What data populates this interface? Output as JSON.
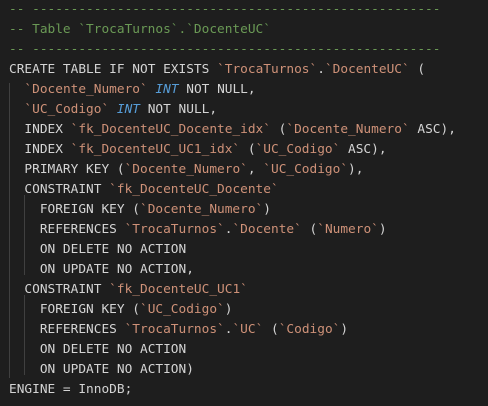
{
  "editor": {
    "lines": [
      [
        {
          "t": "-- -----------------------------------------------------",
          "c": "cmt"
        }
      ],
      [
        {
          "t": "-- Table `TrocaTurnos`.`DocenteUC`",
          "c": "cmt"
        }
      ],
      [
        {
          "t": "-- -----------------------------------------------------",
          "c": "cmt"
        }
      ],
      [
        {
          "t": "CREATE TABLE ",
          "c": "kw"
        },
        {
          "t": "IF NOT EXISTS",
          "c": "kw"
        },
        {
          "t": " ",
          "c": "pn"
        },
        {
          "t": "`TrocaTurnos`",
          "c": "str"
        },
        {
          "t": ".",
          "c": "pn"
        },
        {
          "t": "`DocenteUC`",
          "c": "str"
        },
        {
          "t": " (",
          "c": "pn"
        }
      ],
      [
        {
          "t": "  ",
          "c": "pn"
        },
        {
          "t": "`Docente_Numero`",
          "c": "str"
        },
        {
          "t": " ",
          "c": "pn"
        },
        {
          "t": "INT",
          "c": "typ"
        },
        {
          "t": " NOT NULL,",
          "c": "kw"
        }
      ],
      [
        {
          "t": "  ",
          "c": "pn"
        },
        {
          "t": "`UC_Codigo`",
          "c": "str"
        },
        {
          "t": " ",
          "c": "pn"
        },
        {
          "t": "INT",
          "c": "typ"
        },
        {
          "t": " NOT NULL,",
          "c": "kw"
        }
      ],
      [
        {
          "t": "  INDEX ",
          "c": "kw"
        },
        {
          "t": "`fk_DocenteUC_Docente_idx`",
          "c": "str"
        },
        {
          "t": " (",
          "c": "pn"
        },
        {
          "t": "`Docente_Numero`",
          "c": "str"
        },
        {
          "t": " ASC),",
          "c": "kw"
        }
      ],
      [
        {
          "t": "  INDEX ",
          "c": "kw"
        },
        {
          "t": "`fk_DocenteUC_UC1_idx`",
          "c": "str"
        },
        {
          "t": " (",
          "c": "pn"
        },
        {
          "t": "`UC_Codigo`",
          "c": "str"
        },
        {
          "t": " ASC),",
          "c": "kw"
        }
      ],
      [
        {
          "t": "  PRIMARY KEY (",
          "c": "kw"
        },
        {
          "t": "`Docente_Numero`",
          "c": "str"
        },
        {
          "t": ", ",
          "c": "pn"
        },
        {
          "t": "`UC_Codigo`",
          "c": "str"
        },
        {
          "t": "),",
          "c": "pn"
        }
      ],
      [
        {
          "t": "  CONSTRAINT ",
          "c": "kw"
        },
        {
          "t": "`fk_DocenteUC_Docente`",
          "c": "str"
        }
      ],
      [
        {
          "t": "    FOREIGN KEY (",
          "c": "kw"
        },
        {
          "t": "`Docente_Numero`",
          "c": "str"
        },
        {
          "t": ")",
          "c": "pn"
        }
      ],
      [
        {
          "t": "    REFERENCES ",
          "c": "kw"
        },
        {
          "t": "`TrocaTurnos`",
          "c": "str"
        },
        {
          "t": ".",
          "c": "pn"
        },
        {
          "t": "`Docente`",
          "c": "str"
        },
        {
          "t": " (",
          "c": "pn"
        },
        {
          "t": "`Numero`",
          "c": "str"
        },
        {
          "t": ")",
          "c": "pn"
        }
      ],
      [
        {
          "t": "    ON DELETE ",
          "c": "kw"
        },
        {
          "t": "NO ACTION",
          "c": "kw"
        }
      ],
      [
        {
          "t": "    ON UPDATE ",
          "c": "kw"
        },
        {
          "t": "NO ACTION,",
          "c": "kw"
        }
      ],
      [
        {
          "t": "  CONSTRAINT ",
          "c": "kw"
        },
        {
          "t": "`fk_DocenteUC_UC1`",
          "c": "str"
        }
      ],
      [
        {
          "t": "    FOREIGN KEY (",
          "c": "kw"
        },
        {
          "t": "`UC_Codigo`",
          "c": "str"
        },
        {
          "t": ")",
          "c": "pn"
        }
      ],
      [
        {
          "t": "    REFERENCES ",
          "c": "kw"
        },
        {
          "t": "`TrocaTurnos`",
          "c": "str"
        },
        {
          "t": ".",
          "c": "pn"
        },
        {
          "t": "`UC`",
          "c": "str"
        },
        {
          "t": " (",
          "c": "pn"
        },
        {
          "t": "`Codigo`",
          "c": "str"
        },
        {
          "t": ")",
          "c": "pn"
        }
      ],
      [
        {
          "t": "    ON DELETE ",
          "c": "kw"
        },
        {
          "t": "NO ACTION",
          "c": "kw"
        }
      ],
      [
        {
          "t": "    ON UPDATE ",
          "c": "kw"
        },
        {
          "t": "NO ACTION)",
          "c": "kw"
        }
      ],
      [
        {
          "t": "ENGINE = InnoDB;",
          "c": "kw"
        }
      ]
    ]
  },
  "colors": {
    "background": "#1e1e1e",
    "comment": "#6a9955",
    "keyword": "#d4d4d4",
    "string": "#ce9178",
    "type": "#569cd6"
  }
}
